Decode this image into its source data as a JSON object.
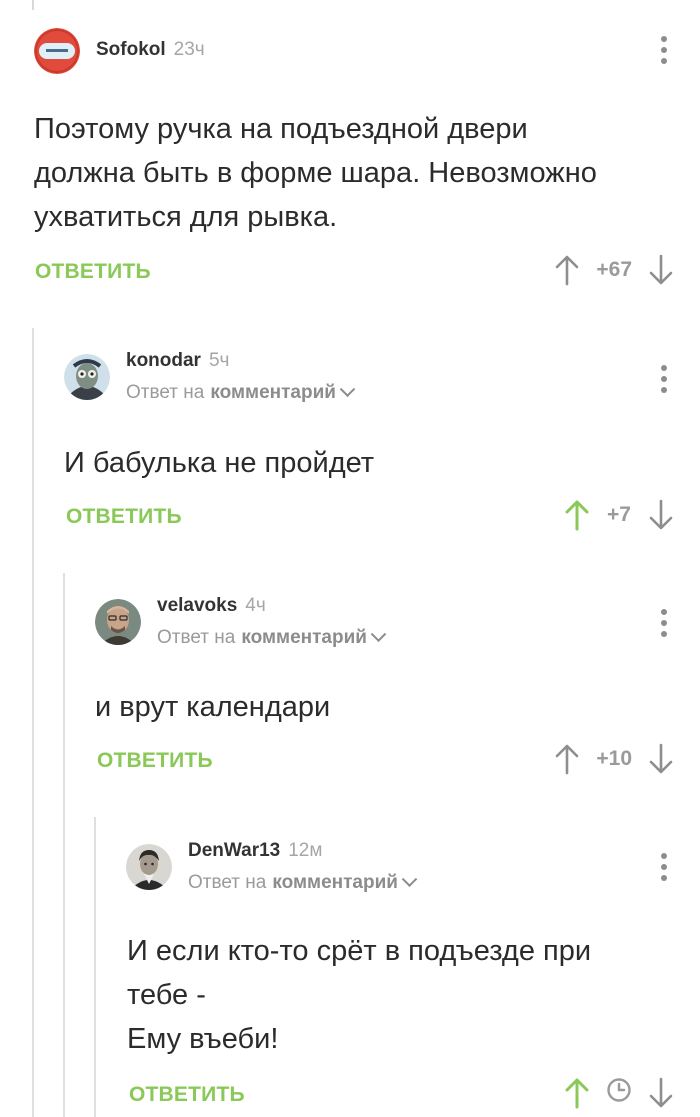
{
  "comments": [
    {
      "username": "Sofokol",
      "time": "23ч",
      "text": "Поэтому ручка на подъездной двери\nдолжна быть в форме шара. Невозможно\nухватиться для рывка.",
      "reply_label": "ОТВЕТИТЬ",
      "rating": "+67",
      "upvoted": false
    },
    {
      "username": "konodar",
      "time": "5ч",
      "reply_to_prefix": "Ответ на",
      "reply_to_link": "комментарий",
      "text": "И бабулька не пройдет",
      "reply_label": "ОТВЕТИТЬ",
      "rating": "+7",
      "upvoted": true
    },
    {
      "username": "velavoks",
      "time": "4ч",
      "reply_to_prefix": "Ответ на",
      "reply_to_link": "комментарий",
      "text": "и врут календари",
      "reply_label": "ОТВЕТИТЬ",
      "rating": "+10",
      "upvoted": false
    },
    {
      "username": "DenWar13",
      "time": "12м",
      "reply_to_prefix": "Ответ на",
      "reply_to_link": "комментарий",
      "text": "И если кто-то срёт в подъезде при\nтебе -\nЕму въеби!",
      "reply_label": "ОТВЕТИТЬ",
      "rating_pending": "clock-icon",
      "upvoted": true
    }
  ],
  "colors": {
    "accent_green": "#8ac858",
    "text": "#2b2b2b",
    "muted": "#9a9a9a"
  }
}
